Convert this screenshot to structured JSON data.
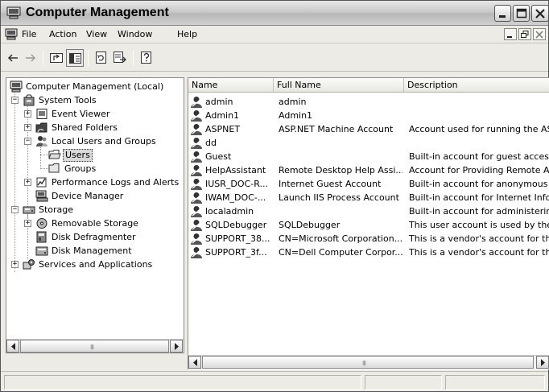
{
  "window": {
    "title": "Computer Management"
  },
  "menu": {
    "items": [
      "File",
      "Action",
      "View",
      "Window",
      "Help"
    ]
  },
  "toolbar": {
    "buttons": [
      "back-icon",
      "forward-icon",
      "up-level-icon",
      "show-hide-tree-icon",
      "refresh-icon",
      "export-list-icon",
      "help-icon"
    ]
  },
  "tree": {
    "root": "Computer Management (Local)",
    "system_tools": "System Tools",
    "event_viewer": "Event Viewer",
    "shared_folders": "Shared Folders",
    "local_users_groups": "Local Users and Groups",
    "users": "Users",
    "groups": "Groups",
    "performance_logs": "Performance Logs and Alerts",
    "device_manager": "Device Manager",
    "storage": "Storage",
    "removable_storage": "Removable Storage",
    "disk_defragmenter": "Disk Defragmenter",
    "disk_management": "Disk Management",
    "services_apps": "Services and Applications",
    "selected": "Users"
  },
  "list": {
    "columns": [
      "Name",
      "Full Name",
      "Description"
    ],
    "rows": [
      {
        "name": "admin",
        "full_name": "admin",
        "description": ""
      },
      {
        "name": "Admin1",
        "full_name": "Admin1",
        "description": ""
      },
      {
        "name": "ASPNET",
        "full_name": "ASP.NET Machine Account",
        "description": "Account used for running the ASP."
      },
      {
        "name": "dd",
        "full_name": "",
        "description": ""
      },
      {
        "name": "Guest",
        "full_name": "",
        "description": "Built-in account for guest access to"
      },
      {
        "name": "HelpAssistant",
        "full_name": "Remote Desktop Help Assi...",
        "description": "Account for Providing Remote Assis"
      },
      {
        "name": "IUSR_DOC-R...",
        "full_name": "Internet Guest Account",
        "description": "Built-in account for anonymous acc"
      },
      {
        "name": "IWAM_DOC-...",
        "full_name": "Launch IIS Process Account",
        "description": "Built-in account for Internet Inform"
      },
      {
        "name": "localadmin",
        "full_name": "",
        "description": "Built-in account for administering th"
      },
      {
        "name": "SQLDebugger",
        "full_name": "SQLDebugger",
        "description": "This user account is used by the Vi"
      },
      {
        "name": "SUPPORT_38...",
        "full_name": "CN=Microsoft Corporation...",
        "description": "This is a vendor's account for the H"
      },
      {
        "name": "SUPPORT_3f...",
        "full_name": "CN=Dell Computer Corpor...",
        "description": "This is a vendor's account for the H"
      }
    ]
  },
  "scrollbars": {
    "grip": "III"
  }
}
